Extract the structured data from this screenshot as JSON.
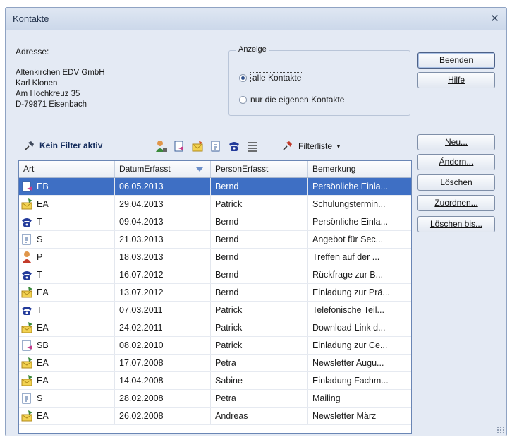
{
  "window": {
    "title": "Kontakte"
  },
  "address": {
    "heading": "Adresse:",
    "lines": [
      "Altenkirchen EDV GmbH",
      "Karl Klonen",
      "Am Hochkreuz 35",
      "D-79871 Eisenbach"
    ]
  },
  "display_group": {
    "legend": "Anzeige",
    "options": [
      {
        "label": "alle Kontakte",
        "checked": true
      },
      {
        "label": "nur die eigenen Kontakte",
        "checked": false
      }
    ]
  },
  "buttons": {
    "close": "Beenden",
    "help": "Hilfe",
    "new": "Neu...",
    "edit": "Ändern...",
    "delete": "Löschen",
    "assign": "Zuordnen...",
    "delete_until": "Löschen bis..."
  },
  "toolbar": {
    "filter_status": "Kein Filter aktiv",
    "filter_list": "Filterliste"
  },
  "table": {
    "columns": [
      "Art",
      "DatumErfasst",
      "PersonErfasst",
      "Bemerkung"
    ],
    "sorted_column": "DatumErfasst",
    "rows": [
      {
        "icon": "email-out-icon",
        "art": "EB",
        "date": "06.05.2013",
        "person": "Bernd",
        "note": "Persönliche Einla...",
        "selected": true
      },
      {
        "icon": "letter-out-icon",
        "art": "EA",
        "date": "29.04.2013",
        "person": "Patrick",
        "note": "Schulungstermin..."
      },
      {
        "icon": "phone-icon",
        "art": "T",
        "date": "09.04.2013",
        "person": "Bernd",
        "note": "Persönliche Einla..."
      },
      {
        "icon": "document-icon",
        "art": "S",
        "date": "21.03.2013",
        "person": "Bernd",
        "note": "Angebot für Sec..."
      },
      {
        "icon": "person-icon",
        "art": "P",
        "date": "18.03.2013",
        "person": "Bernd",
        "note": "Treffen auf der ..."
      },
      {
        "icon": "phone-icon",
        "art": "T",
        "date": "16.07.2012",
        "person": "Bernd",
        "note": "Rückfrage zur B..."
      },
      {
        "icon": "letter-out-icon",
        "art": "EA",
        "date": "13.07.2012",
        "person": "Bernd",
        "note": "Einladung zur Prä..."
      },
      {
        "icon": "phone-icon",
        "art": "T",
        "date": "07.03.2011",
        "person": "Patrick",
        "note": "Telefonische Teil..."
      },
      {
        "icon": "letter-out-icon",
        "art": "EA",
        "date": "24.02.2011",
        "person": "Patrick",
        "note": "Download-Link d..."
      },
      {
        "icon": "email-out-icon",
        "art": "SB",
        "date": "08.02.2010",
        "person": "Patrick",
        "note": "Einladung zur Ce..."
      },
      {
        "icon": "letter-out-icon",
        "art": "EA",
        "date": "17.07.2008",
        "person": "Petra",
        "note": "Newsletter Augu..."
      },
      {
        "icon": "letter-out-icon",
        "art": "EA",
        "date": "14.04.2008",
        "person": "Sabine",
        "note": "Einladung Fachm..."
      },
      {
        "icon": "document-icon",
        "art": "S",
        "date": "28.02.2008",
        "person": "Petra",
        "note": "Mailing"
      },
      {
        "icon": "letter-out-icon",
        "art": "EA",
        "date": "26.02.2008",
        "person": "Andreas",
        "note": "Newsletter März"
      }
    ]
  },
  "colors": {
    "selection": "#3e6fc4",
    "accent": "#30508a",
    "window_bg": "#e4eaf4"
  }
}
